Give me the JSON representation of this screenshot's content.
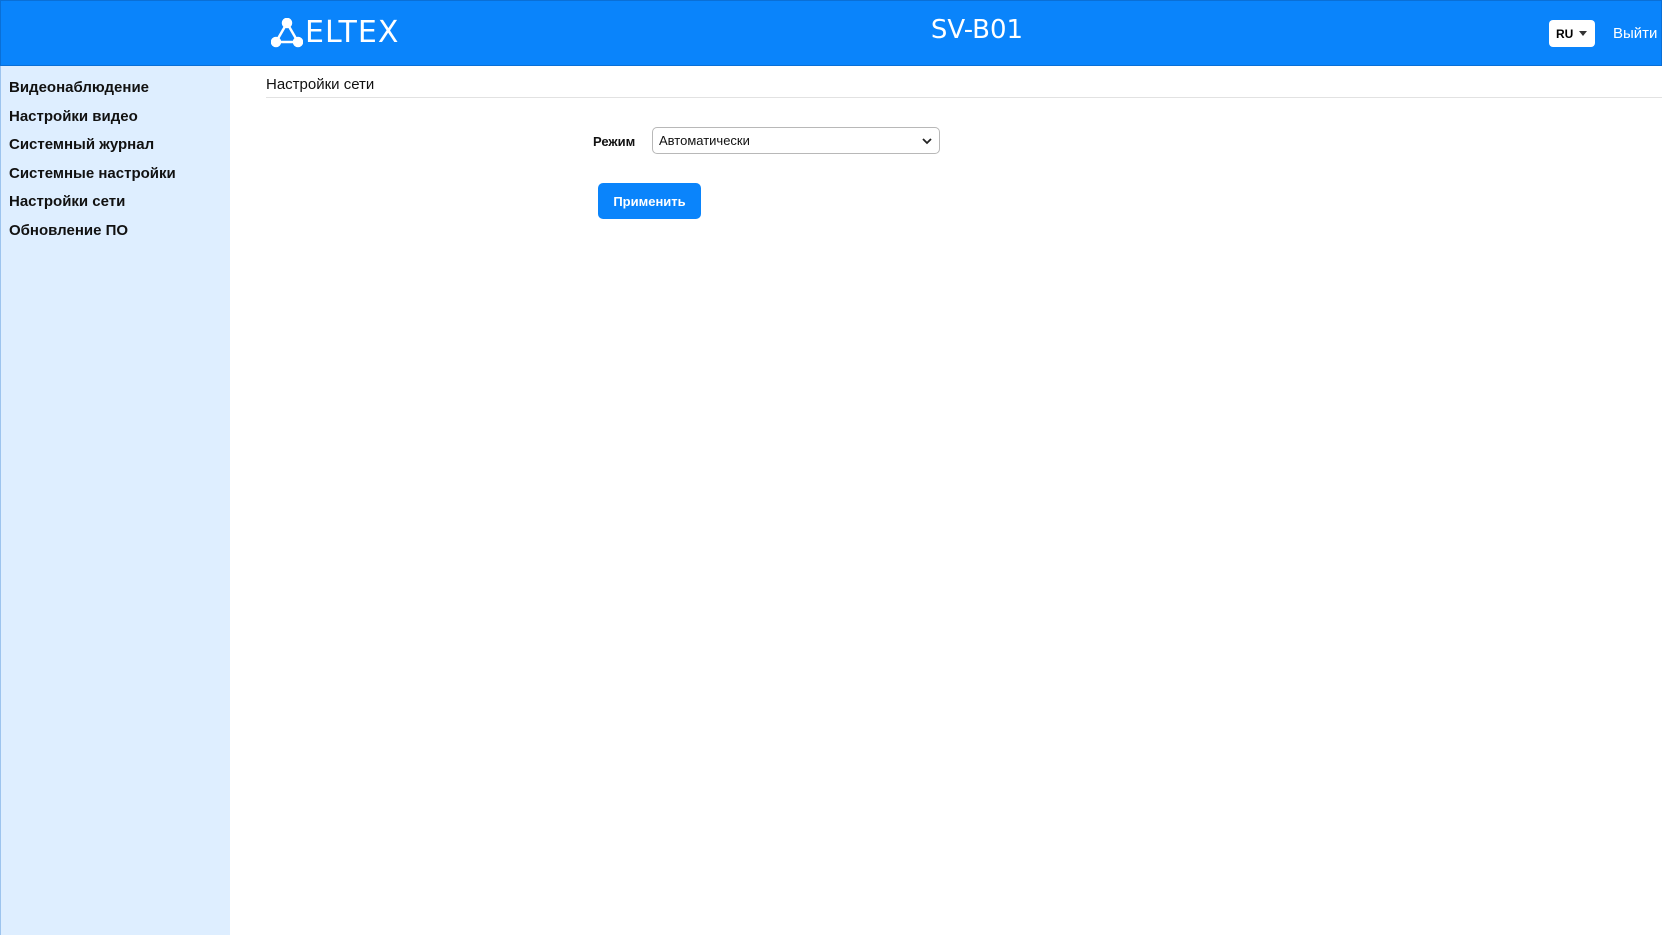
{
  "header": {
    "logo_text": "ELTEX",
    "device_name": "SV-B01",
    "language": "RU",
    "logout_label": "Выйти"
  },
  "sidebar": {
    "items": [
      {
        "label": "Видеонаблюдение"
      },
      {
        "label": "Настройки видео"
      },
      {
        "label": "Системный журнал"
      },
      {
        "label": "Системные настройки"
      },
      {
        "label": "Настройки сети"
      },
      {
        "label": "Обновление ПО"
      }
    ]
  },
  "main": {
    "title": "Настройки сети",
    "mode_label": "Режим",
    "mode_value": "Автоматически",
    "apply_label": "Применить"
  },
  "colors": {
    "header_bg": "#0a84fb",
    "sidebar_bg": "#deeeff",
    "button_bg": "#0a84fb"
  },
  "icons": {
    "logo": "eltex-logo-icon",
    "language_caret": "caret-down-icon",
    "select_chevron": "chevron-down-icon"
  }
}
